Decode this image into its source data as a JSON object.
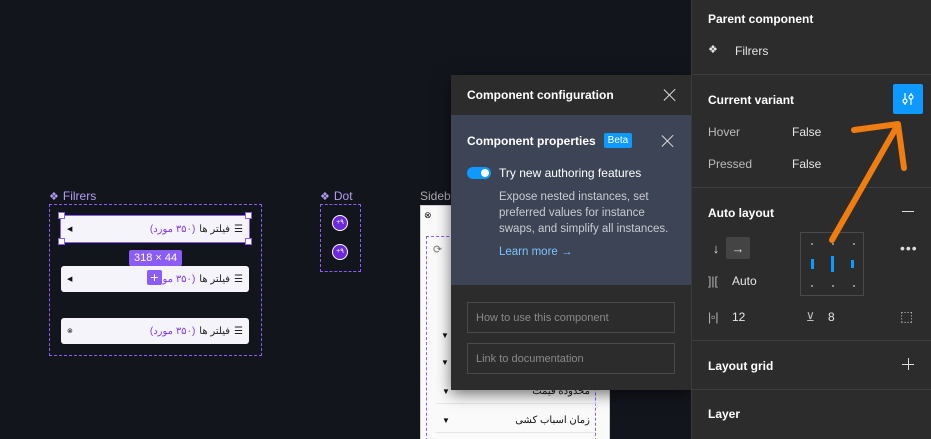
{
  "canvas": {
    "filrers_label": "Filrers",
    "dot_label": "Dot",
    "sidebar_label": "Sideba",
    "filter_rows": [
      {
        "text": "فیلتر ها",
        "count": "(۳۵۰ مورد)"
      },
      {
        "text": "فیلتر ها",
        "count": "(۳۵۰ مورد)"
      },
      {
        "text": "فیلتر ها",
        "count": "(۳۵۰ مورد)"
      }
    ],
    "size_badge": "318 × 44",
    "dot_values": [
      "+۹",
      "+۹"
    ],
    "sidebar_rows": [
      "محدوده قیمت",
      "زمان اسباب کشی"
    ]
  },
  "popup": {
    "title": "Component configuration",
    "props_title": "Component properties",
    "beta": "Beta",
    "toggle_label": "Try new authoring features",
    "description": "Expose nested instances, set preferred values for instance swaps, and simplify all instances.",
    "learn_more": "Learn more →",
    "how_to_placeholder": "How to use this component",
    "docs_placeholder": "Link to documentation"
  },
  "panel": {
    "parent_title": "Parent component",
    "parent_name": "Filrers",
    "variant_title": "Current variant",
    "props": [
      {
        "name": "Hover",
        "value": "False"
      },
      {
        "name": "Pressed",
        "value": "False"
      }
    ],
    "auto_layout_title": "Auto layout",
    "auto_label": "Auto",
    "padding_h": "12",
    "spacing": "8",
    "layout_grid_title": "Layout grid",
    "layer_title": "Layer"
  },
  "colors": {
    "accent": "#0d99ff",
    "selection": "#8b5cf6",
    "annotation": "#f07d12"
  }
}
